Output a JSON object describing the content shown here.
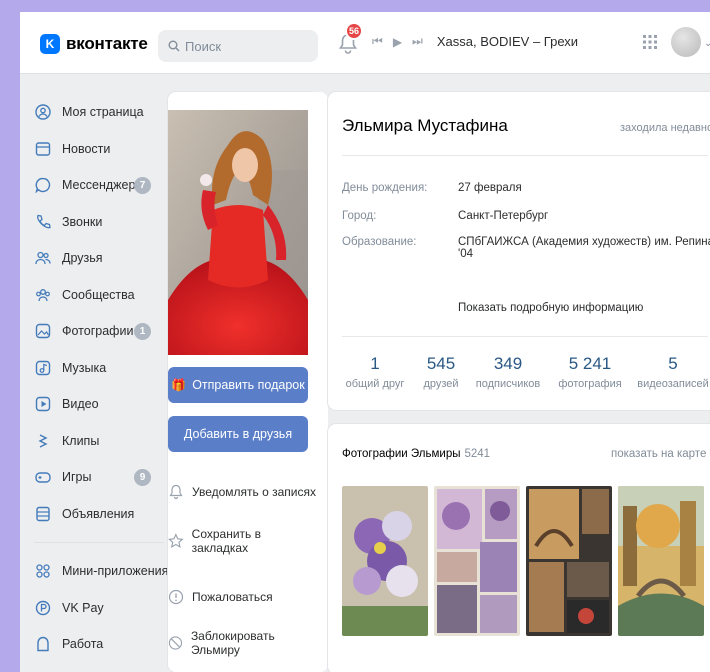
{
  "header": {
    "logo_text": "вконтакте",
    "logo_mark": "K",
    "search_placeholder": "Поиск",
    "notifications_count": "56",
    "track": "Xassa, BODIEV – Грехи"
  },
  "sidebar": {
    "items": [
      {
        "label": "Моя страница",
        "icon": "user-circle-icon"
      },
      {
        "label": "Новости",
        "icon": "newspaper-icon"
      },
      {
        "label": "Мессенджер",
        "icon": "message-icon",
        "badge": "7"
      },
      {
        "label": "Звонки",
        "icon": "phone-icon"
      },
      {
        "label": "Друзья",
        "icon": "friends-icon"
      },
      {
        "label": "Сообщества",
        "icon": "communities-icon"
      },
      {
        "label": "Фотографии",
        "icon": "photo-icon",
        "badge": "1"
      },
      {
        "label": "Музыка",
        "icon": "music-icon"
      },
      {
        "label": "Видео",
        "icon": "video-icon"
      },
      {
        "label": "Клипы",
        "icon": "clips-icon"
      },
      {
        "label": "Игры",
        "icon": "games-icon",
        "badge": "9"
      },
      {
        "label": "Объявления",
        "icon": "ads-icon"
      }
    ],
    "items2": [
      {
        "label": "Мини-приложения",
        "icon": "mini-apps-icon"
      },
      {
        "label": "VK Pay",
        "icon": "vkpay-icon"
      },
      {
        "label": "Работа",
        "icon": "work-icon"
      }
    ]
  },
  "profile": {
    "send_gift": "Отправить подарок",
    "add_friend": "Добавить в друзья",
    "actions": {
      "notify": "Уведомлять о записях",
      "bookmark": "Сохранить в закладках",
      "report": "Пожаловаться",
      "block": "Заблокировать Эльмиру"
    }
  },
  "info": {
    "name": "Эльмира Мустафина",
    "status": "заходила недавно",
    "birthday_label": "День рождения:",
    "birthday_value": "27 февраля",
    "city_label": "Город:",
    "city_value": "Санкт-Петербург",
    "edu_label": "Образование:",
    "edu_value": "СПбГАИЖСА (Академия художеств) им. Репина '04",
    "more": "Показать подробную информацию",
    "counters": [
      {
        "num": "1",
        "label": "общий друг"
      },
      {
        "num": "545",
        "label": "друзей"
      },
      {
        "num": "349",
        "label": "подписчиков"
      },
      {
        "num": "5 241",
        "label": "фотография"
      },
      {
        "num": "5",
        "label": "видеозаписей"
      }
    ]
  },
  "photos": {
    "title": "Фотографии Эльмиры",
    "count": "5241",
    "map_link": "показать на карте"
  },
  "colors": {
    "accent": "#0077ff",
    "button": "#5a7ec8",
    "background": "#b3a9eb",
    "link": "#2a5885"
  }
}
